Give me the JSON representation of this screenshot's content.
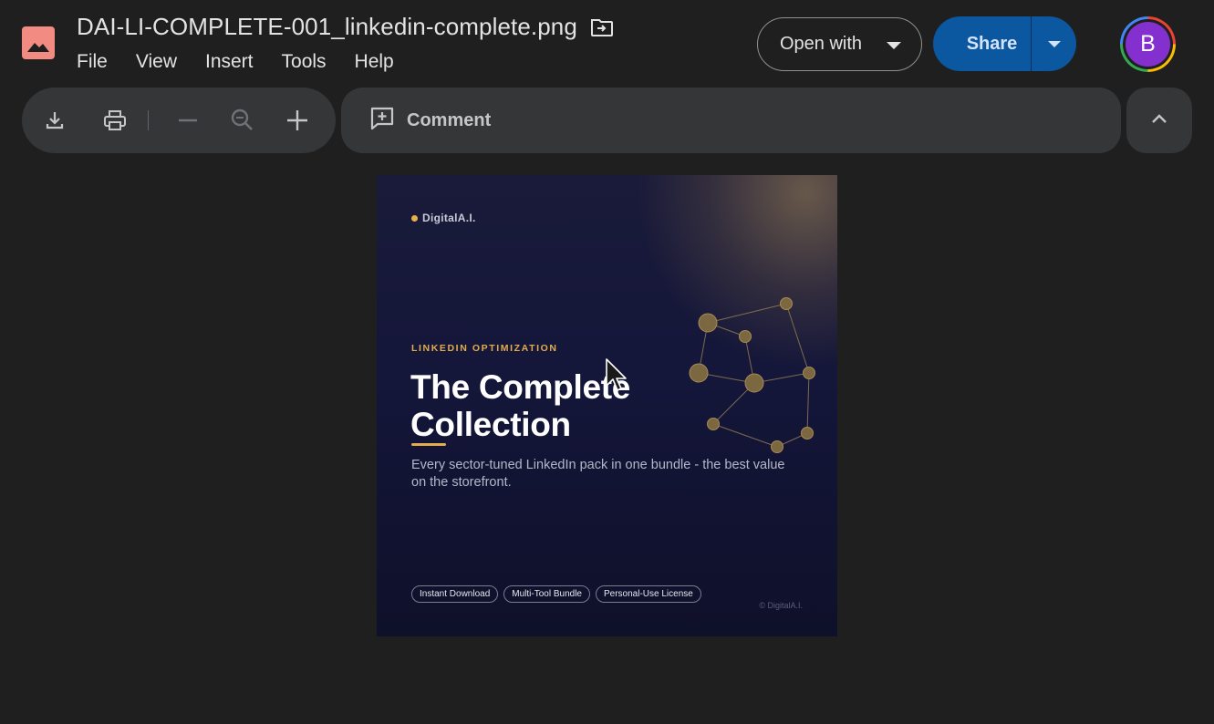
{
  "header": {
    "file_title": "DAI-LI-COMPLETE-001_linkedin-complete.png",
    "file_icon": "image-icon",
    "move_icon": "folder-move-icon"
  },
  "menu": [
    "File",
    "View",
    "Insert",
    "Tools",
    "Help"
  ],
  "actions": {
    "open_with": "Open with",
    "share": "Share",
    "avatar_initial": "B"
  },
  "toolbar": {
    "buttons": [
      "download-icon",
      "print-icon",
      "zoom-out-icon",
      "zoom-reset-icon",
      "zoom-in-icon"
    ],
    "comment": "Comment",
    "collapse_icon": "chevron-up-icon"
  },
  "preview": {
    "brand": "DigitalA.I.",
    "eyebrow": "LINKEDIN OPTIMIZATION",
    "headline_line1": "The Complete",
    "headline_line2": "Collection",
    "description": "Every sector-tuned LinkedIn pack in one bundle - the best value on the storefront.",
    "tags": [
      "Instant Download",
      "Multi-Tool Bundle",
      "Personal-Use License"
    ],
    "copyright": "© DigitalA.I."
  },
  "colors": {
    "share": "#0b57a0",
    "avatar": "#8430ce",
    "accent_gold": "#e3ac4c",
    "file_icon": "#f28b82"
  }
}
